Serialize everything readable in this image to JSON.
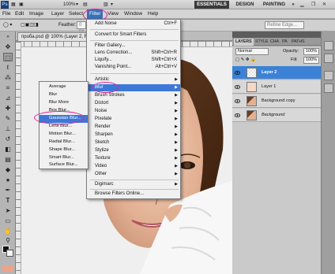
{
  "app": {
    "logo": "Ps",
    "zoom": "100%",
    "workspaces": [
      "ESSENTIALS",
      "DESIGN",
      "PAINTING",
      "»"
    ]
  },
  "menubar": [
    "File",
    "Edit",
    "Image",
    "Layer",
    "Select",
    "Filter",
    "View",
    "Window",
    "Help"
  ],
  "options": {
    "feather_label": "Feather:",
    "feather_value": "0 px",
    "refine_edge": "Refine Edge..."
  },
  "document": {
    "tab": "проба.psd @ 100% (Layer 2, RGB/8) *"
  },
  "filter_menu": {
    "add_noise": "Add Noise",
    "add_noise_shortcut": "Ctrl+F",
    "convert": "Convert for Smart Filters",
    "filter_gallery": "Filter Gallery...",
    "lens_correction": "Lens Correction...",
    "lens_correction_shortcut": "Shift+Ctrl+R",
    "liquify": "Liquify...",
    "liquify_shortcut": "Shift+Ctrl+X",
    "vanishing_point": "Vanishing Point...",
    "vanishing_point_shortcut": "Alt+Ctrl+V",
    "submenus": [
      "Artistic",
      "Blur",
      "Brush Strokes",
      "Distort",
      "Noise",
      "Pixelate",
      "Render",
      "Sharpen",
      "Sketch",
      "Stylize",
      "Texture",
      "Video",
      "Other"
    ],
    "digimarc": "Digimarc",
    "browse": "Browse Filters Online..."
  },
  "blur_submenu": [
    "Average",
    "Blur",
    "Blur More",
    "Box Blur...",
    "Gaussian Blur...",
    "Lens Blur...",
    "Motion Blur...",
    "Radial Blur...",
    "Shape Blur...",
    "Smart Blur...",
    "Surface Blur..."
  ],
  "layers_panel": {
    "tabs": [
      "LAYERS",
      "STYLE",
      "CHA",
      "PA",
      "PATHS"
    ],
    "blend_mode": "Normal",
    "opacity_label": "Opacity:",
    "opacity_value": "100%",
    "fill_label": "Fill:",
    "fill_value": "100%",
    "layers": [
      "Layer 2",
      "Layer 1",
      "Background copy",
      "Background"
    ]
  },
  "colors": {
    "highlight": "#3c78d8",
    "annotation": "#e0249a",
    "active_layer": "#3b82d6"
  }
}
